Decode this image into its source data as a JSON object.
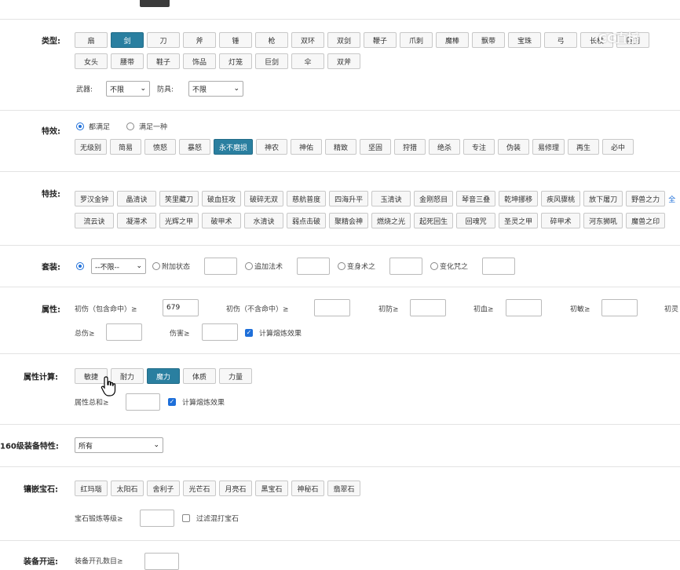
{
  "type_section": {
    "label": "类型:",
    "row1": [
      "扇",
      "剑",
      "刀",
      "斧",
      "锤",
      "枪",
      "双环",
      "双剑",
      "鞭子",
      "爪刺",
      "魔棒",
      "飘带",
      "宝珠",
      "弓",
      "长杖",
      "巨剑"
    ],
    "row2": [
      "女头",
      "腰带",
      "鞋子",
      "饰品",
      "灯笼",
      "巨剑",
      "伞",
      "双斧"
    ],
    "active": "剑",
    "weapon_label": "武器:",
    "weapon_value": "不限",
    "armor_label": "防具:",
    "armor_value": "不限"
  },
  "effect_section": {
    "label": "特效:",
    "radio_all": "都满足",
    "radio_any": "满足一种",
    "buttons": [
      "无级别",
      "简易",
      "愤怒",
      "暴怒",
      "永不磨损",
      "神农",
      "神佑",
      "精致",
      "坚固",
      "狩猎",
      "绝杀",
      "专注",
      "伪装",
      "易修理",
      "再生",
      "必中"
    ],
    "active": "永不磨损"
  },
  "skill_section": {
    "label": "特技:",
    "row1": [
      "罗汉金钟",
      "晶清诀",
      "笑里藏刀",
      "破血狂攻",
      "破碎无双",
      "慈航普度",
      "四海升平",
      "玉清诀",
      "金刚怒目",
      "琴音三叠",
      "乾坤挪移",
      "疾风骤桃",
      "放下屠刀",
      "野兽之力"
    ],
    "row1_more": "全",
    "row2": [
      "流云诀",
      "凝滞术",
      "光辉之甲",
      "破甲术",
      "水清诀",
      "弱点击破",
      "聚精会神",
      "燃烧之光",
      "起死回生",
      "回魂咒",
      "圣灵之甲",
      "碎甲术",
      "河东狮吼",
      "魔兽之印"
    ]
  },
  "set_section": {
    "label": "套装:",
    "select_value": "--不限--",
    "options": [
      "附加状态",
      "追加法术",
      "变身术之",
      "变化咒之"
    ]
  },
  "attr_section": {
    "label": "属性:",
    "fields": [
      "初伤（包含命中）≥",
      "初伤（不含命中）≥",
      "初防≥",
      "初血≥",
      "初敏≥",
      "初灵"
    ],
    "first_value": "679",
    "total_dmg": "总伤≥",
    "dmg": "伤害≥",
    "refine_label": "计算熔炼效果"
  },
  "calc_section": {
    "label": "属性计算:",
    "buttons": [
      "敏捷",
      "耐力",
      "魔力",
      "体质",
      "力量"
    ],
    "active": "魔力",
    "sum_label": "属性总和≥",
    "refine_label": "计算熔炼效果"
  },
  "lv160_section": {
    "label": "160级装备特性:",
    "select_value": "所有"
  },
  "gem_section": {
    "label": "镶嵌宝石:",
    "buttons": [
      "红玛瑙",
      "太阳石",
      "舍利子",
      "光芒石",
      "月亮石",
      "黑宝石",
      "神秘石",
      "翡翠石"
    ],
    "level_label": "宝石锻炼等级≥",
    "filter_label": "过滤混打宝石"
  },
  "hole_section": {
    "label": "装备开运:",
    "count_label": "装备开孔数目≥"
  },
  "watermark": "CC直播",
  "colors": {
    "active": "#2a7fa0",
    "link": "#1e6fd9"
  }
}
